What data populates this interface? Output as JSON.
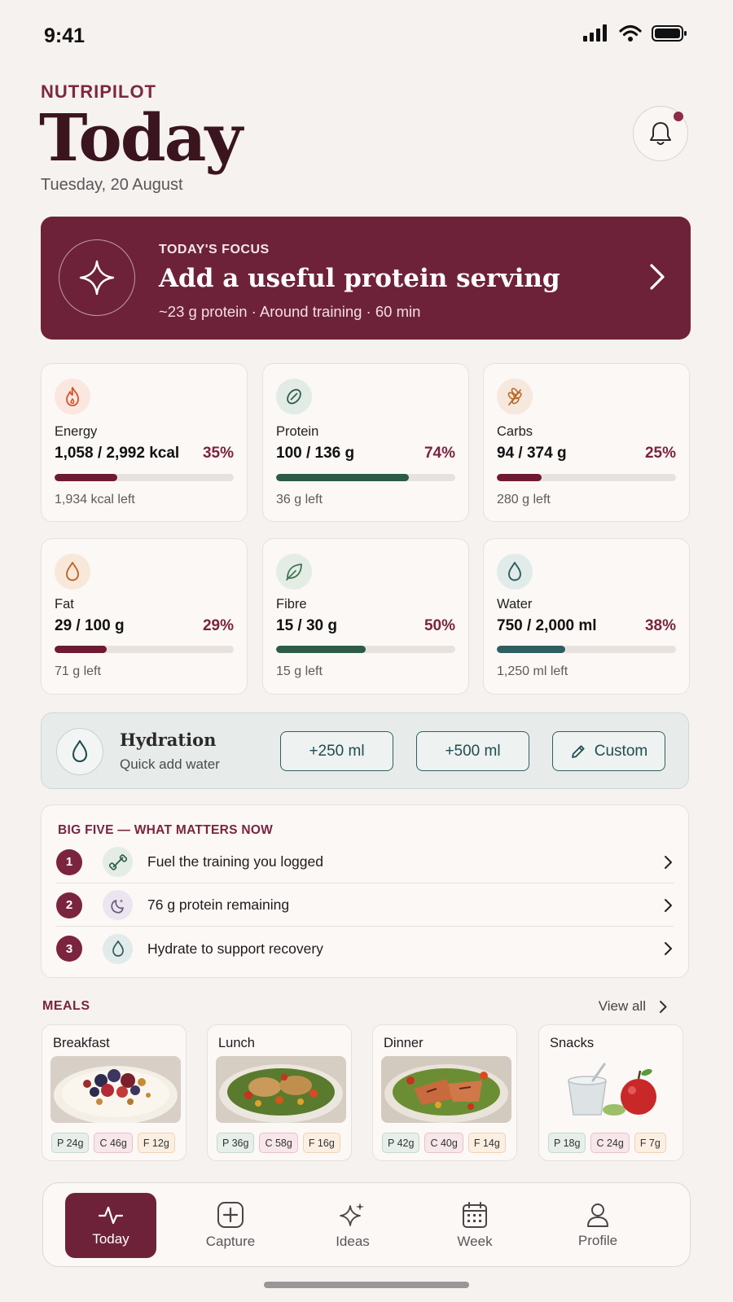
{
  "status_bar": {
    "time": "9:41"
  },
  "header": {
    "brand": "NUTRIPILOT",
    "title": "Today",
    "date": "Tuesday, 20 August"
  },
  "focus": {
    "kicker": "TODAY'S FOCUS",
    "title": "Add a useful protein serving",
    "subtitle": "~23 g protein · Around training · 60 min"
  },
  "metrics": [
    {
      "label": "Energy",
      "value": "1,058 / 2,992 kcal",
      "pct": "35%",
      "progress": 0.35,
      "left": "1,934 kcal left",
      "color": "#6e1a30",
      "icon": "flame-icon"
    },
    {
      "label": "Protein",
      "value": "100 / 136 g",
      "pct": "74%",
      "progress": 0.74,
      "left": "36 g left",
      "color": "#2d5b48",
      "icon": "protein-icon"
    },
    {
      "label": "Carbs",
      "value": "94 / 374 g",
      "pct": "25%",
      "progress": 0.25,
      "left": "280 g left",
      "color": "#6e1a30",
      "icon": "wheat-icon"
    },
    {
      "label": "Fat",
      "value": "29 / 100 g",
      "pct": "29%",
      "progress": 0.29,
      "left": "71 g left",
      "color": "#6e1a30",
      "icon": "fat-drop-icon"
    },
    {
      "label": "Fibre",
      "value": "15 / 30 g",
      "pct": "50%",
      "progress": 0.5,
      "left": "15 g left",
      "color": "#2d5b48",
      "icon": "leaf-icon"
    },
    {
      "label": "Water",
      "value": "750 / 2,000 ml",
      "pct": "38%",
      "progress": 0.38,
      "left": "1,250 ml left",
      "color": "#2f5e60",
      "icon": "water-drop-icon"
    }
  ],
  "hydration": {
    "title": "Hydration",
    "subtitle": "Quick add water",
    "buttons": [
      "+250 ml",
      "+500 ml",
      "Custom"
    ]
  },
  "big_five": {
    "title": "BIG FIVE — WHAT MATTERS NOW",
    "items": [
      {
        "num": "1",
        "label": "Fuel the training you logged",
        "icon": "dumbbell-icon"
      },
      {
        "num": "2",
        "label": "76 g protein remaining",
        "icon": "moon-icon"
      },
      {
        "num": "3",
        "label": "Hydrate to support recovery",
        "icon": "water-drop-icon"
      }
    ]
  },
  "meals": {
    "heading": "MEALS",
    "view_all": "View all",
    "items": [
      {
        "name": "Breakfast",
        "p": "P 24g",
        "c": "C 46g",
        "f": "F 12g"
      },
      {
        "name": "Lunch",
        "p": "P 36g",
        "c": "C 58g",
        "f": "F 16g"
      },
      {
        "name": "Dinner",
        "p": "P 42g",
        "c": "C 40g",
        "f": "F 14g"
      },
      {
        "name": "Snacks",
        "p": "P 18g",
        "c": "C 24g",
        "f": "F 7g"
      }
    ]
  },
  "tabs": [
    {
      "label": "Today",
      "icon": "activity-icon",
      "active": true
    },
    {
      "label": "Capture",
      "icon": "plus-square-icon",
      "active": false
    },
    {
      "label": "Ideas",
      "icon": "sparkles-icon",
      "active": false
    },
    {
      "label": "Week",
      "icon": "calendar-icon",
      "active": false
    },
    {
      "label": "Profile",
      "icon": "user-icon",
      "active": false
    }
  ]
}
